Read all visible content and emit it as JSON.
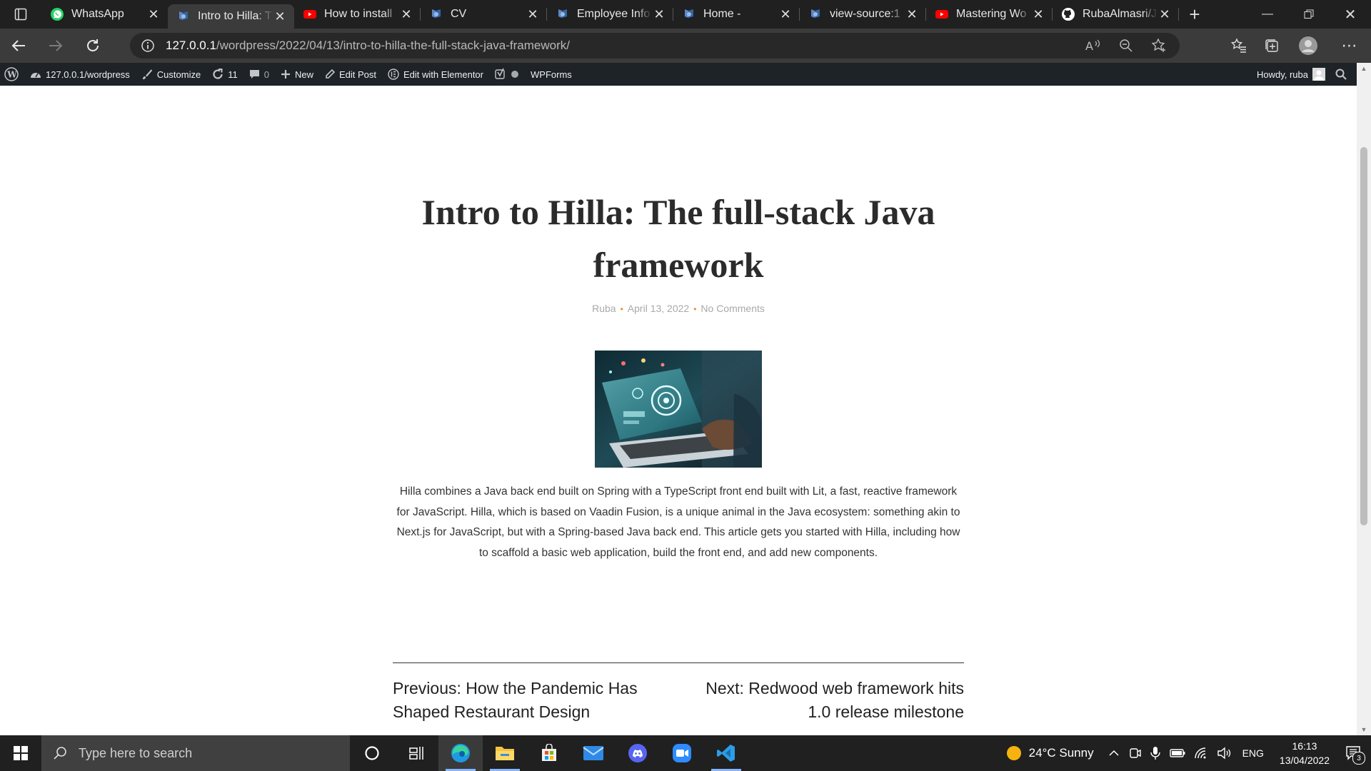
{
  "browser": {
    "tabs": [
      {
        "title": "WhatsApp",
        "favicon": "whatsapp-icon",
        "active": false
      },
      {
        "title": "Intro to Hilla: T",
        "favicon": "wordpress-tab-icon",
        "active": true
      },
      {
        "title": "How to install",
        "favicon": "youtube-icon",
        "active": false
      },
      {
        "title": "CV",
        "favicon": "wordpress-tab-icon",
        "active": false
      },
      {
        "title": "Employee Info",
        "favicon": "wordpress-tab-icon",
        "active": false
      },
      {
        "title": "Home -",
        "favicon": "wordpress-tab-icon",
        "active": false
      },
      {
        "title": "view-source:1",
        "favicon": "wordpress-tab-icon",
        "active": false
      },
      {
        "title": "Mastering Wo",
        "favicon": "youtube-icon",
        "active": false
      },
      {
        "title": "RubaAlmasri/J",
        "favicon": "github-icon",
        "active": false
      }
    ],
    "url_host": "127.0.0.1",
    "url_path": "/wordpress/2022/04/13/intro-to-hilla-the-full-stack-java-framework/"
  },
  "adminbar": {
    "site": "127.0.0.1/wordpress",
    "customize": "Customize",
    "updates": "11",
    "comments": "0",
    "new": "New",
    "edit_post": "Edit Post",
    "elementor": "Edit with Elementor",
    "wpforms": "WPForms",
    "howdy": "Howdy, ruba"
  },
  "post": {
    "title": "Intro to Hilla: The full-stack Java framework",
    "author": "Ruba",
    "date": "April 13, 2022",
    "comments": "No Comments",
    "excerpt": "Hilla combines a Java back end built on Spring with a TypeScript front end built with Lit, a fast, reactive framework for JavaScript. Hilla, which is based on Vaadin Fusion, is a unique animal in the Java ecosystem: something akin to Next.js for JavaScript, but with a Spring-based Java back end. This article gets you started with Hilla, including how to scaffold a basic web application, build the front end, and add new components.",
    "prev_label": "Previous: How the Pandemic Has Shaped Restaurant Design",
    "next_label": "Next: Redwood web framework hits 1.0 release milestone"
  },
  "taskbar": {
    "search_placeholder": "Type here to search",
    "weather": "24°C  Sunny",
    "language": "ENG",
    "time": "16:13",
    "date": "13/04/2022",
    "notifications": "3"
  }
}
